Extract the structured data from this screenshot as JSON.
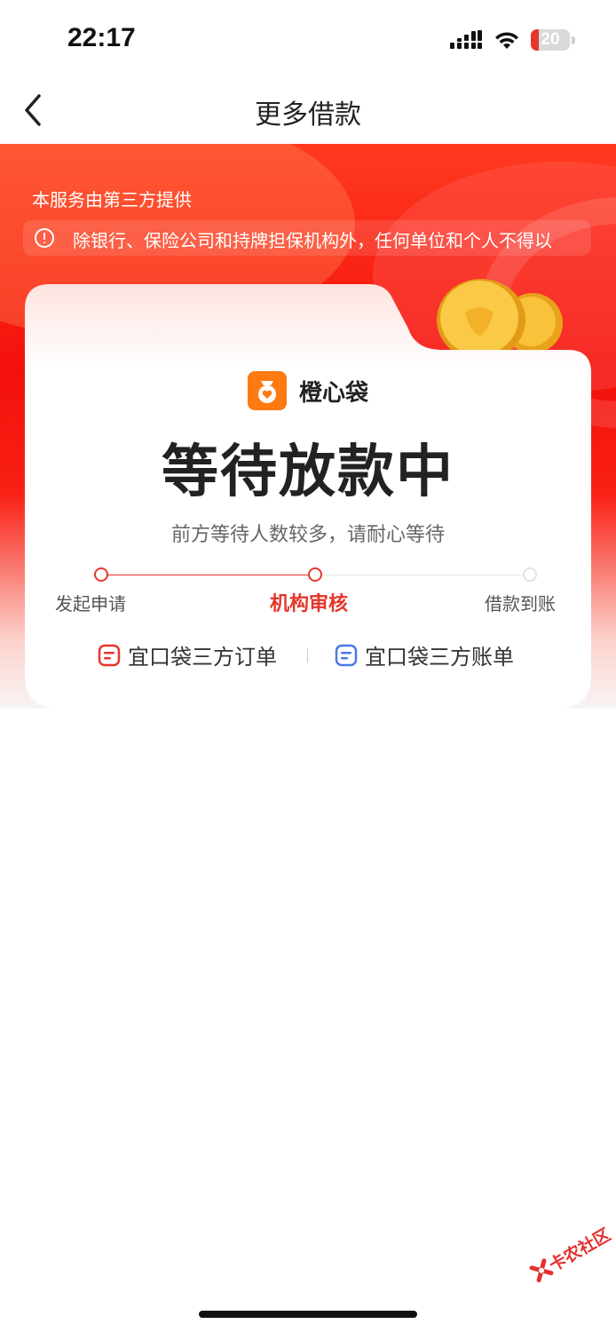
{
  "status_bar": {
    "time": "22:17",
    "battery_level": "20"
  },
  "nav": {
    "title": "更多借款"
  },
  "hero": {
    "provider_note": "本服务由第三方提供",
    "notice": "除银行、保险公司和持牌担保机构外，任何单位和个人不得以"
  },
  "card": {
    "brand_name": "橙心袋",
    "status_title": "等待放款中",
    "status_subtitle": "前方等待人数较多，请耐心等待",
    "steps": [
      {
        "label": "发起申请",
        "state": "done"
      },
      {
        "label": "机构审核",
        "state": "active"
      },
      {
        "label": "借款到账",
        "state": "pending"
      }
    ],
    "links": [
      {
        "label": "宜口袋三方订单",
        "icon": "order-icon",
        "color": "#e5372b"
      },
      {
        "label": "宜口袋三方账单",
        "icon": "bill-icon",
        "color": "#4a78e8"
      }
    ]
  },
  "watermark": {
    "text": "卡农社区"
  },
  "colors": {
    "accent": "#e5372b",
    "hero_red": "#f3110c",
    "brand_orange": "#ff7a10"
  }
}
